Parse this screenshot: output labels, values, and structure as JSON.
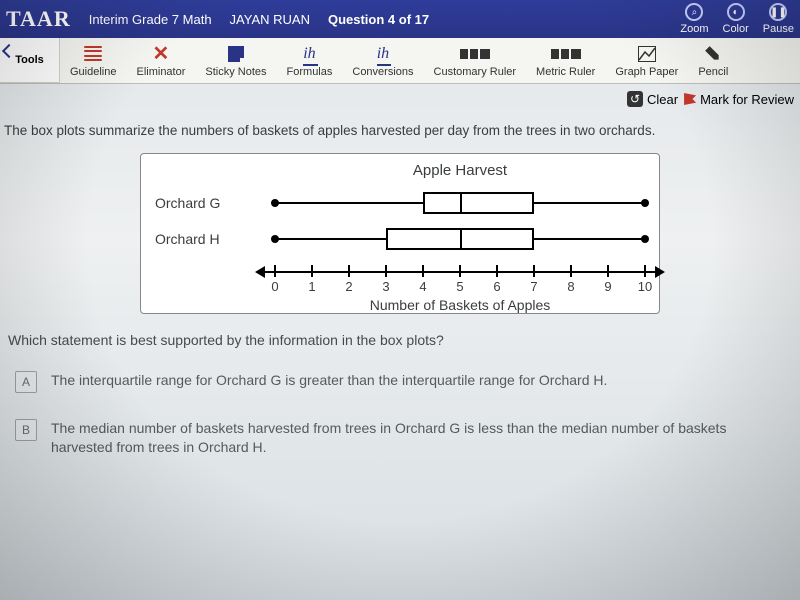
{
  "header": {
    "brand": "TAAR",
    "assessment": "Interim Grade 7 Math",
    "student": "JAYAN RUAN",
    "question_label": "Question 4 of 17",
    "right_icons": {
      "zoom": "Zoom",
      "color": "Color",
      "pause": "Pause"
    }
  },
  "toolbar": {
    "label": "Tools",
    "items": {
      "guideline": "Guideline",
      "eliminator": "Eliminator",
      "sticky": "Sticky Notes",
      "formulas": "Formulas",
      "conversions": "Conversions",
      "cust_ruler": "Customary Ruler",
      "met_ruler": "Metric Ruler",
      "graph": "Graph Paper",
      "pencil": "Pencil"
    }
  },
  "actions": {
    "clear": "Clear",
    "mark": "Mark for Review"
  },
  "question": {
    "stem": "The box plots summarize the numbers of baskets of apples harvested per day from the trees in two orchards.",
    "prompt": "Which statement is best supported by the information in the box plots?"
  },
  "chart_data": {
    "type": "boxplot",
    "title": "Apple Harvest",
    "xlabel": "Number of Baskets of Apples",
    "xlim": [
      0,
      10
    ],
    "ticks": [
      0,
      1,
      2,
      3,
      4,
      5,
      6,
      7,
      8,
      9,
      10
    ],
    "series": [
      {
        "name": "Orchard G",
        "min": 0,
        "q1": 4,
        "median": 5,
        "q3": 7,
        "max": 10
      },
      {
        "name": "Orchard H",
        "min": 0,
        "q1": 3,
        "median": 5,
        "q3": 7,
        "max": 10
      }
    ]
  },
  "answers": [
    {
      "letter": "A",
      "text": "The interquartile range for Orchard G is greater than the interquartile range for Orchard H."
    },
    {
      "letter": "B",
      "text": "The median number of baskets harvested from trees in Orchard G is less than the median number of baskets harvested from trees in Orchard H."
    }
  ]
}
